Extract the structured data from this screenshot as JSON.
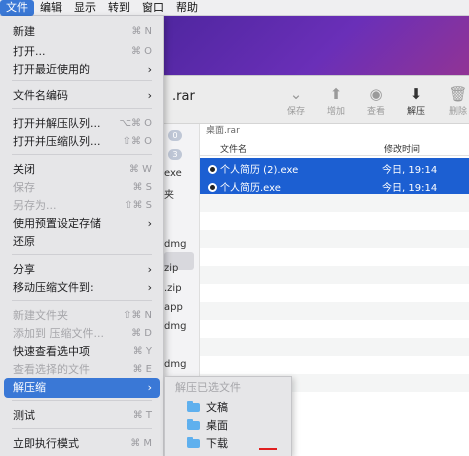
{
  "menubar": {
    "items": [
      "文件",
      "编辑",
      "显示",
      "转到",
      "窗口",
      "帮助"
    ]
  },
  "window": {
    "title": ".rar",
    "toolbar": [
      "保存",
      "增加",
      "查看",
      "解压",
      "删除"
    ],
    "sidebar_badges": [
      "0",
      "3"
    ],
    "sidebar_items": [
      "exe",
      "夹",
      "dmg",
      "zip",
      ".zip",
      "app",
      "dmg",
      "dmg"
    ],
    "path": "桌面.rar",
    "columns": {
      "name": "文件名",
      "date": "修改时间"
    },
    "files": [
      {
        "name": "个人简历 (2).exe",
        "date": "今日, 19:14"
      },
      {
        "name": "个人简历.exe",
        "date": "今日, 19:14"
      }
    ]
  },
  "menu": {
    "items": [
      {
        "label": "新建",
        "shortcut": "⌘ N"
      },
      {
        "label": "打开...",
        "shortcut": "⌘ O"
      },
      {
        "label": "打开最近使用的",
        "arrow": "›"
      },
      {
        "label": "文件名编码",
        "arrow": "›"
      },
      {
        "label": "打开并解压队列...",
        "shortcut": "⌥⌘ O"
      },
      {
        "label": "打开并压缩队列...",
        "shortcut": "⇧⌘ O"
      },
      {
        "label": "关闭",
        "shortcut": "⌘ W"
      },
      {
        "label": "保存",
        "shortcut": "⌘ S"
      },
      {
        "label": "另存为...",
        "shortcut": "⇧⌘ S"
      },
      {
        "label": "使用预置设定存储",
        "arrow": "›"
      },
      {
        "label": "还原"
      },
      {
        "label": "分享",
        "arrow": "›"
      },
      {
        "label": "移动压缩文件到:",
        "arrow": "›"
      },
      {
        "label": "新建文件夹",
        "shortcut": "⇧⌘ N"
      },
      {
        "label": "添加到 压缩文件...",
        "shortcut": "⌘ D"
      },
      {
        "label": "快速查看选中项",
        "shortcut": "⌘ Y"
      },
      {
        "label": "查看选择的文件",
        "shortcut": "⌘ E"
      },
      {
        "label": "解压缩",
        "arrow": "›"
      },
      {
        "label": "测试",
        "shortcut": "⌘ T"
      },
      {
        "label": "立即执行模式",
        "shortcut": "⌘ M"
      }
    ]
  },
  "submenu": {
    "header": "解压已选文件",
    "items": [
      "文稿",
      "桌面",
      "下载"
    ]
  }
}
